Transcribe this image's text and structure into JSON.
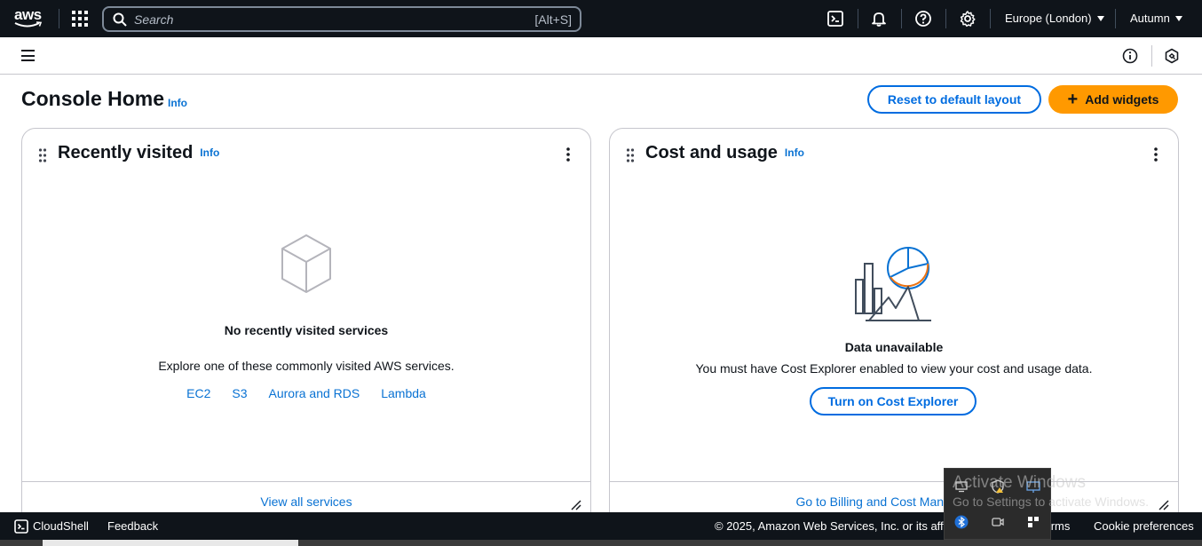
{
  "topnav": {
    "logo_text": "aws",
    "search_placeholder": "Search",
    "search_shortcut": "[Alt+S]",
    "region": "Europe (London)",
    "account": "Autumn"
  },
  "header": {
    "title": "Console Home",
    "info": "Info",
    "reset_button": "Reset to default layout",
    "add_button": "Add widgets"
  },
  "recent_widget": {
    "title": "Recently visited",
    "info": "Info",
    "empty_heading": "No recently visited services",
    "explore_text": "Explore one of these commonly visited AWS services.",
    "services": [
      "EC2",
      "S3",
      "Aurora and RDS",
      "Lambda"
    ],
    "footer_link": "View all services"
  },
  "cost_widget": {
    "title": "Cost and usage",
    "info": "Info",
    "empty_heading": "Data unavailable",
    "message": "You must have Cost Explorer enabled to view your cost and usage data.",
    "button": "Turn on Cost Explorer",
    "footer_link": "Go to Billing and Cost Management"
  },
  "footer": {
    "cloudshell": "CloudShell",
    "feedback": "Feedback",
    "copyright": "© 2025, Amazon Web Services, Inc. or its affiliates.",
    "terms": "Terms",
    "cookies": "Cookie preferences"
  },
  "windows_overlay": {
    "activate_title": "Activate Windows",
    "activate_sub": "Go to Settings to activate Windows."
  },
  "colors": {
    "nav_bg": "#0f141a",
    "link": "#0972d3",
    "primary": "#ff9900",
    "border": "#c6c6cd"
  }
}
